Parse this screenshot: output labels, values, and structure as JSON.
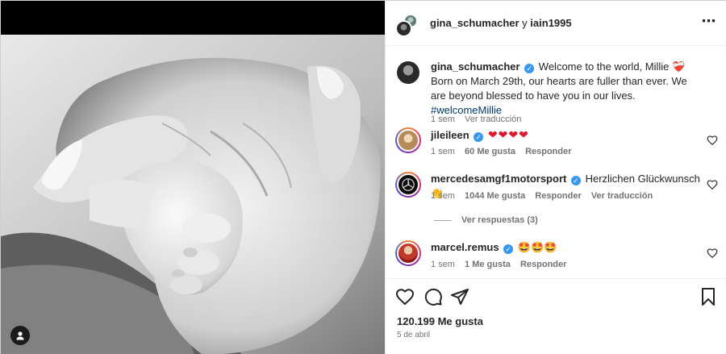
{
  "header": {
    "user1": "gina_schumacher",
    "connector": "y",
    "user2": "iain1995",
    "more_icon": "⋯"
  },
  "caption": {
    "username": "gina_schumacher",
    "text_part1": "Welcome to the world, Millie",
    "emoji": "❤️‍🩹",
    "text_part2": "Born on March 29th, our hearts are fuller than ever. We are beyond blessed to have you in our lives.",
    "hashtag": "#welcomeMillie",
    "time": "1 sem",
    "translate": "Ver traducción"
  },
  "comments": [
    {
      "username": "jileileen",
      "text": "❤❤❤❤",
      "time": "1 sem",
      "likes": "60 Me gusta",
      "reply": "Responder"
    },
    {
      "username": "mercedesamgf1motorsport",
      "text": "Herzlichen Glückwunsch",
      "emoji": "👏",
      "time": "1 sem",
      "likes": "1044 Me gusta",
      "reply": "Responder",
      "translate": "Ver traducción",
      "view_replies": "Ver respuestas (3)"
    },
    {
      "username": "marcel.remus",
      "text": "🤩🤩🤩",
      "time": "1 sem",
      "likes": "1 Me gusta",
      "reply": "Responder"
    }
  ],
  "post": {
    "likes": "120.199 Me gusta",
    "date": "5 de abril"
  },
  "colors": {
    "verified": "#3897f0",
    "hashtag": "#00376b",
    "muted": "#737373",
    "heart_red": "#e0162b"
  }
}
